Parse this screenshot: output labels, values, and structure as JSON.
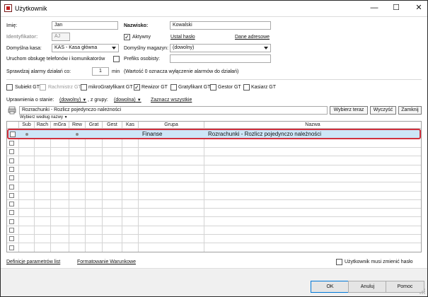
{
  "window": {
    "title": "Użytkownik",
    "minimize_glyph": "—",
    "maximize_glyph": "☐",
    "close_glyph": "✕"
  },
  "form": {
    "first_name_label": "Imię:",
    "first_name_value": "Jan",
    "last_name_label": "Nazwisko:",
    "last_name_value": "Kowalski",
    "identifier_label": "Identyfikator:",
    "identifier_value": "AJ",
    "active_label": "Aktywny",
    "active_checked": true,
    "set_password_link": "Ustal hasło",
    "address_data_link": "Dane adresowe",
    "default_cash_label": "Domyślna kasa:",
    "default_cash_value": "KAS - Kasa główna",
    "default_warehouse_label": "Domyślny magazyn:",
    "default_warehouse_value": "(dowolny)",
    "phone_service_label": "Uruchom obsługę telefonów i komunikatorów",
    "prefix_label": "Prefiks osobisty:",
    "prefix_value": "",
    "alarm_check_label": "Sprawdzaj alarmy działań co:",
    "alarm_minutes_value": "1",
    "alarm_minutes_unit": "min",
    "alarm_note": "(Wartość 0 oznacza wyłączenie alarmów do działań)"
  },
  "roles": [
    {
      "label": "Subiekt GT",
      "checked": false,
      "disabled": false
    },
    {
      "label": "Rachmistrz GT",
      "checked": false,
      "disabled": true
    },
    {
      "label": "mikroGratyfikant GT",
      "checked": false,
      "disabled": false
    },
    {
      "label": "Rewizor GT",
      "checked": true,
      "disabled": false
    },
    {
      "label": "Gratyfikant GT",
      "checked": false,
      "disabled": false
    },
    {
      "label": "Gestor GT",
      "checked": false,
      "disabled": false
    },
    {
      "label": "Kasiarz GT",
      "checked": false,
      "disabled": false
    }
  ],
  "permissions": {
    "state_label": "Uprawnienia o stanie:",
    "state_value": "(dowolny)",
    "group_label": ", z grupy:",
    "group_value": "(dowolna)",
    "select_all_link": "Zaznacz wszystkie",
    "search_value": "Rozrachunki - Rozlicz pojedynczo należności",
    "search_by_label": "Wybierz według nazwy",
    "select_now_button": "Wybierz teraz",
    "clear_button": "Wyczyść",
    "close_button": "Zamknij"
  },
  "grid": {
    "columns": [
      "Sub",
      "Rach",
      "mGra",
      "Rew",
      "Grat",
      "Gest",
      "Kas",
      "Grupa",
      "Nazwa"
    ],
    "rows": [
      {
        "sub": true,
        "rach": false,
        "mgra": false,
        "rew": true,
        "grat": false,
        "gest": false,
        "kas": false,
        "group": "Finanse",
        "name": "Rozrachunki - Rozlicz pojedynczo należności",
        "selected": true
      }
    ],
    "empty_row_count": 13
  },
  "bottom": {
    "param_defs_link": "Definicje parametrów list",
    "conditional_format_link": "Formatowanie Warunkowe",
    "must_change_password_label": "Użytkownik musi zmienić hasło",
    "must_change_password_checked": false
  },
  "footer": {
    "ok_label": "OK",
    "cancel_label": "Anuluj",
    "help_label": "Pomoc"
  },
  "colors": {
    "selection_fill": "#cde6f7",
    "selection_outline": "#d0303e",
    "accent": "#0078d7"
  }
}
